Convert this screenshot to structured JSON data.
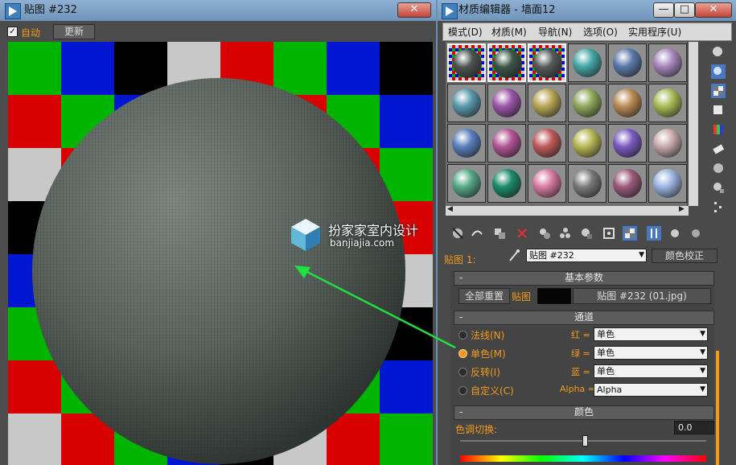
{
  "preview_window": {
    "title": "贴图 #232",
    "close_label": "✕",
    "auto_label": "自动",
    "auto_checked": true,
    "update_label": "更新"
  },
  "editor_window": {
    "title": "材质编辑器 - 墙面12",
    "minimize_label": "—",
    "restore_label": "□",
    "close_label": "✕",
    "menu": [
      "模式(D)",
      "材质(M)",
      "导航(N)",
      "选项(O)",
      "实用程序(U)"
    ],
    "slot_colors": [
      [
        "#4c5450",
        "#3c5548",
        "#555a59",
        "#46a8a8",
        "#5b7bab",
        "#a888bf"
      ],
      [
        "#5a98ad",
        "#9b55a8",
        "#b8a655",
        "#8ea85a",
        "#bb8a55",
        "#a8bb55"
      ],
      [
        "#5a7fbf",
        "#b25594",
        "#c05a5a",
        "#b8b855",
        "#7a5ac0",
        "#c8aaaa"
      ],
      [
        "#55a888",
        "#1c8a6a",
        "#d87aa0",
        "#7a7a7a",
        "#9a5a7a",
        "#9ab4e0"
      ]
    ],
    "map_label": "贴图 1:",
    "map_name": "贴图 #232",
    "color_correction_label": "颜色校正",
    "basic_params": {
      "header": "基本参数",
      "reset_all_label": "全部重置",
      "map_label": "贴图",
      "map_file": "贴图 #232 (01.jpg)"
    },
    "channels": {
      "header": "通道",
      "options": [
        {
          "label": "法线(N)",
          "selected": false,
          "channel": "红 =",
          "value": "单色"
        },
        {
          "label": "单色(M)",
          "selected": true,
          "channel": "绿 =",
          "value": "单色"
        },
        {
          "label": "反转(I)",
          "selected": false,
          "channel": "蓝 =",
          "value": "单色"
        },
        {
          "label": "自定义(C)",
          "selected": false,
          "channel": "Alpha =",
          "value": "Alpha"
        }
      ]
    },
    "color": {
      "header": "颜色",
      "hue_shift_label": "色调切换:",
      "hue_shift_value": "0.0"
    }
  },
  "watermark": {
    "name": "扮家家室内设计",
    "url": "banjiajia.com"
  },
  "checker_colors": [
    [
      "#00b400",
      "#0016d0",
      "#000000",
      "#c8c8c8",
      "#d80000",
      "#00b400",
      "#0016d0",
      "#000000"
    ],
    [
      "#d80000",
      "#00b400",
      "#0016d0",
      "#000000",
      "#c8c8c8",
      "#d80000",
      "#00b400",
      "#0016d0"
    ],
    [
      "#c8c8c8",
      "#d80000",
      "#00b400",
      "#0016d0",
      "#000000",
      "#c8c8c8",
      "#d80000",
      "#00b400"
    ],
    [
      "#000000",
      "#c8c8c8",
      "#d80000",
      "#00b400",
      "#0016d0",
      "#000000",
      "#c8c8c8",
      "#d80000"
    ],
    [
      "#0016d0",
      "#000000",
      "#c8c8c8",
      "#d80000",
      "#00b400",
      "#0016d0",
      "#000000",
      "#c8c8c8"
    ],
    [
      "#00b400",
      "#0016d0",
      "#000000",
      "#c8c8c8",
      "#d80000",
      "#00b400",
      "#0016d0",
      "#000000"
    ],
    [
      "#d80000",
      "#00b400",
      "#0016d0",
      "#000000",
      "#c8c8c8",
      "#d80000",
      "#00b400",
      "#0016d0"
    ],
    [
      "#c8c8c8",
      "#d80000",
      "#00b400",
      "#0016d0",
      "#000000",
      "#c8c8c8",
      "#d80000",
      "#00b400"
    ]
  ]
}
